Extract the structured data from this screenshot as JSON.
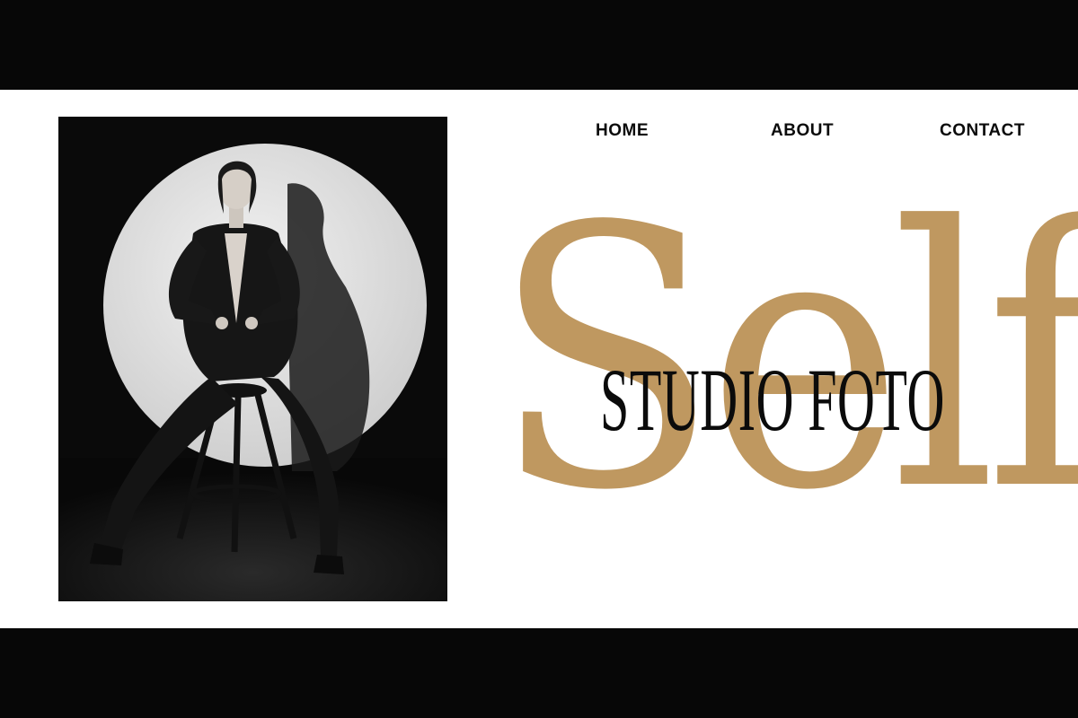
{
  "nav": {
    "home": "HOME",
    "about": "ABOUT",
    "contact": "CONTACT"
  },
  "hero": {
    "word": "Self",
    "subtitle": "STUDIO FOTO"
  },
  "colors": {
    "accent": "#bf9860",
    "text": "#0b0b0b",
    "background": "#ffffff",
    "letterbox": "#070707"
  }
}
